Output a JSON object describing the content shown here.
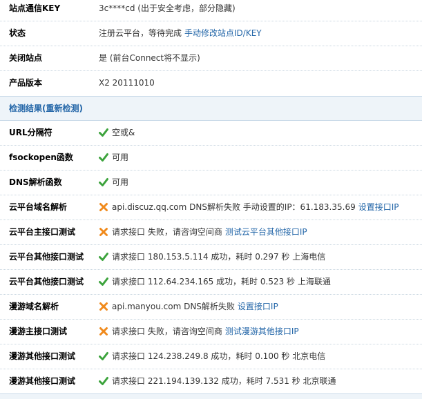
{
  "info": {
    "site_key": {
      "label": "站点通信KEY",
      "value": "3c****cd (出于安全考虑，部分隐藏)"
    },
    "status": {
      "label": "状态",
      "value": "注册云平台，等待完成",
      "link": "手动修改站点ID/KEY"
    },
    "close_site": {
      "label": "关闭站点",
      "value": "是 (前台Connect将不显示)"
    },
    "version": {
      "label": "产品版本",
      "value": "X2 20111010"
    }
  },
  "section": {
    "title": "检测结果(重新检测)"
  },
  "checks": {
    "url_sep": {
      "label": "URL分隔符",
      "status": "ok",
      "value": "空或&"
    },
    "fsockopen": {
      "label": "fsockopen函数",
      "status": "ok",
      "value": "可用"
    },
    "dns": {
      "label": "DNS解析函数",
      "status": "ok",
      "value": "可用"
    },
    "cloud_dns": {
      "label": "云平台域名解析",
      "status": "fail",
      "value": "api.discuz.qq.com DNS解析失败  手动设置的IP：61.183.35.69",
      "link": "设置接口IP"
    },
    "cloud_main": {
      "label": "云平台主接口测试",
      "status": "fail",
      "value": "请求接口 失败，请咨询空间商",
      "link": "测试云平台其他接口IP"
    },
    "cloud_other1": {
      "label": "云平台其他接口测试",
      "status": "ok",
      "value": "请求接口  180.153.5.114 成功，耗时  0.297 秒  上海电信"
    },
    "cloud_other2": {
      "label": "云平台其他接口测试",
      "status": "ok",
      "value": "请求接口  112.64.234.165 成功，耗时  0.523 秒  上海联通"
    },
    "manyou_dns": {
      "label": "漫游域名解析",
      "status": "fail",
      "value": "api.manyou.com DNS解析失败",
      "link": "设置接口IP"
    },
    "manyou_main": {
      "label": "漫游主接口测试",
      "status": "fail",
      "value": "请求接口 失败，请咨询空间商",
      "link": "测试漫游其他接口IP"
    },
    "manyou_other1": {
      "label": "漫游其他接口测试",
      "status": "ok",
      "value": "请求接口  124.238.249.8 成功，耗时  0.100 秒  北京电信"
    },
    "manyou_other2": {
      "label": "漫游其他接口测试",
      "status": "ok",
      "value": "请求接口  221.194.139.132 成功，耗时  7.531 秒  北京联通"
    }
  },
  "colors": {
    "ok": "#3ca33c",
    "fail": "#f08a1c",
    "link": "#2366a8",
    "section_bg": "#eef4f9"
  }
}
